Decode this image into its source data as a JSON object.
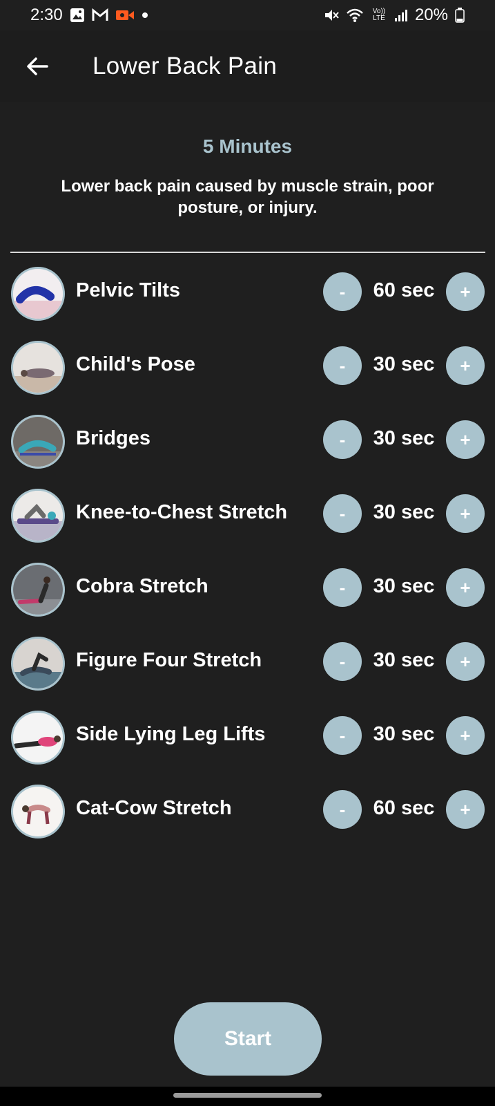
{
  "status_bar": {
    "time": "2:30",
    "battery": "20%",
    "left_icons": [
      "gallery-icon",
      "gmail-icon",
      "video-record-icon",
      "dot-icon"
    ],
    "right_icons": [
      "mute-icon",
      "wifi-icon",
      "volte-icon",
      "signal-icon",
      "battery-icon"
    ],
    "volte_label": "Vo)) LTE"
  },
  "header": {
    "title": "Lower Back Pain",
    "back_icon": "arrow-left-icon"
  },
  "summary": {
    "duration": "5 Minutes",
    "description": "Lower back pain caused by muscle strain, poor posture, or injury."
  },
  "controls": {
    "minus_label": "-",
    "plus_label": "+"
  },
  "exercises": [
    {
      "name": "Pelvic Tilts",
      "duration": "60 sec",
      "thumb_color": "#2233a8"
    },
    {
      "name": "Child's Pose",
      "duration": "30 sec",
      "thumb_color": "#7a6a72"
    },
    {
      "name": "Bridges",
      "duration": "30 sec",
      "thumb_color": "#3aa8b8"
    },
    {
      "name": "Knee-to-Chest Stretch",
      "duration": "30 sec",
      "thumb_color": "#5a4a8a"
    },
    {
      "name": "Cobra Stretch",
      "duration": "30 sec",
      "thumb_color": "#c23a6a"
    },
    {
      "name": "Figure Four Stretch",
      "duration": "30 sec",
      "thumb_color": "#3a4a5a"
    },
    {
      "name": "Side Lying Leg Lifts",
      "duration": "30 sec",
      "thumb_color": "#e0447a"
    },
    {
      "name": "Cat-Cow Stretch",
      "duration": "60 sec",
      "thumb_color": "#8a3a4a"
    }
  ],
  "start_button": {
    "label": "Start"
  },
  "colors": {
    "background": "#1f1f1f",
    "accent": "#a9c3cd",
    "text": "#ffffff"
  }
}
